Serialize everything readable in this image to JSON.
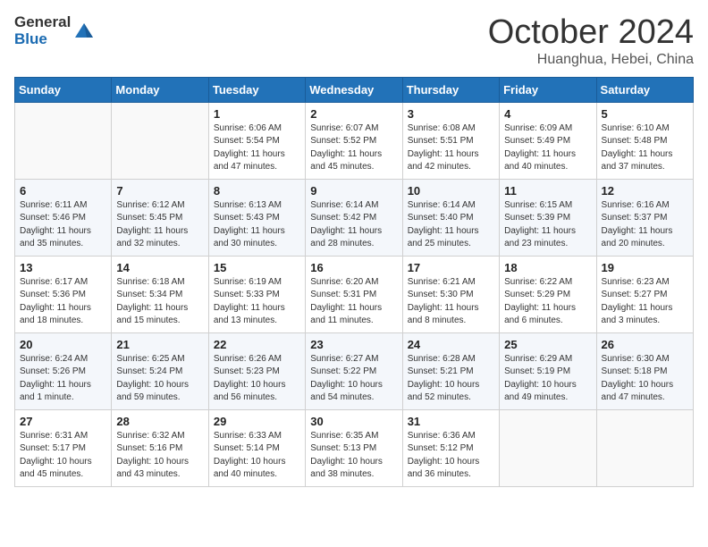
{
  "header": {
    "logo_general": "General",
    "logo_blue": "Blue",
    "month_title": "October 2024",
    "location": "Huanghua, Hebei, China"
  },
  "weekdays": [
    "Sunday",
    "Monday",
    "Tuesday",
    "Wednesday",
    "Thursday",
    "Friday",
    "Saturday"
  ],
  "weeks": [
    [
      null,
      null,
      {
        "day": "1",
        "sunrise": "Sunrise: 6:06 AM",
        "sunset": "Sunset: 5:54 PM",
        "daylight": "Daylight: 11 hours and 47 minutes."
      },
      {
        "day": "2",
        "sunrise": "Sunrise: 6:07 AM",
        "sunset": "Sunset: 5:52 PM",
        "daylight": "Daylight: 11 hours and 45 minutes."
      },
      {
        "day": "3",
        "sunrise": "Sunrise: 6:08 AM",
        "sunset": "Sunset: 5:51 PM",
        "daylight": "Daylight: 11 hours and 42 minutes."
      },
      {
        "day": "4",
        "sunrise": "Sunrise: 6:09 AM",
        "sunset": "Sunset: 5:49 PM",
        "daylight": "Daylight: 11 hours and 40 minutes."
      },
      {
        "day": "5",
        "sunrise": "Sunrise: 6:10 AM",
        "sunset": "Sunset: 5:48 PM",
        "daylight": "Daylight: 11 hours and 37 minutes."
      }
    ],
    [
      {
        "day": "6",
        "sunrise": "Sunrise: 6:11 AM",
        "sunset": "Sunset: 5:46 PM",
        "daylight": "Daylight: 11 hours and 35 minutes."
      },
      {
        "day": "7",
        "sunrise": "Sunrise: 6:12 AM",
        "sunset": "Sunset: 5:45 PM",
        "daylight": "Daylight: 11 hours and 32 minutes."
      },
      {
        "day": "8",
        "sunrise": "Sunrise: 6:13 AM",
        "sunset": "Sunset: 5:43 PM",
        "daylight": "Daylight: 11 hours and 30 minutes."
      },
      {
        "day": "9",
        "sunrise": "Sunrise: 6:14 AM",
        "sunset": "Sunset: 5:42 PM",
        "daylight": "Daylight: 11 hours and 28 minutes."
      },
      {
        "day": "10",
        "sunrise": "Sunrise: 6:14 AM",
        "sunset": "Sunset: 5:40 PM",
        "daylight": "Daylight: 11 hours and 25 minutes."
      },
      {
        "day": "11",
        "sunrise": "Sunrise: 6:15 AM",
        "sunset": "Sunset: 5:39 PM",
        "daylight": "Daylight: 11 hours and 23 minutes."
      },
      {
        "day": "12",
        "sunrise": "Sunrise: 6:16 AM",
        "sunset": "Sunset: 5:37 PM",
        "daylight": "Daylight: 11 hours and 20 minutes."
      }
    ],
    [
      {
        "day": "13",
        "sunrise": "Sunrise: 6:17 AM",
        "sunset": "Sunset: 5:36 PM",
        "daylight": "Daylight: 11 hours and 18 minutes."
      },
      {
        "day": "14",
        "sunrise": "Sunrise: 6:18 AM",
        "sunset": "Sunset: 5:34 PM",
        "daylight": "Daylight: 11 hours and 15 minutes."
      },
      {
        "day": "15",
        "sunrise": "Sunrise: 6:19 AM",
        "sunset": "Sunset: 5:33 PM",
        "daylight": "Daylight: 11 hours and 13 minutes."
      },
      {
        "day": "16",
        "sunrise": "Sunrise: 6:20 AM",
        "sunset": "Sunset: 5:31 PM",
        "daylight": "Daylight: 11 hours and 11 minutes."
      },
      {
        "day": "17",
        "sunrise": "Sunrise: 6:21 AM",
        "sunset": "Sunset: 5:30 PM",
        "daylight": "Daylight: 11 hours and 8 minutes."
      },
      {
        "day": "18",
        "sunrise": "Sunrise: 6:22 AM",
        "sunset": "Sunset: 5:29 PM",
        "daylight": "Daylight: 11 hours and 6 minutes."
      },
      {
        "day": "19",
        "sunrise": "Sunrise: 6:23 AM",
        "sunset": "Sunset: 5:27 PM",
        "daylight": "Daylight: 11 hours and 3 minutes."
      }
    ],
    [
      {
        "day": "20",
        "sunrise": "Sunrise: 6:24 AM",
        "sunset": "Sunset: 5:26 PM",
        "daylight": "Daylight: 11 hours and 1 minute."
      },
      {
        "day": "21",
        "sunrise": "Sunrise: 6:25 AM",
        "sunset": "Sunset: 5:24 PM",
        "daylight": "Daylight: 10 hours and 59 minutes."
      },
      {
        "day": "22",
        "sunrise": "Sunrise: 6:26 AM",
        "sunset": "Sunset: 5:23 PM",
        "daylight": "Daylight: 10 hours and 56 minutes."
      },
      {
        "day": "23",
        "sunrise": "Sunrise: 6:27 AM",
        "sunset": "Sunset: 5:22 PM",
        "daylight": "Daylight: 10 hours and 54 minutes."
      },
      {
        "day": "24",
        "sunrise": "Sunrise: 6:28 AM",
        "sunset": "Sunset: 5:21 PM",
        "daylight": "Daylight: 10 hours and 52 minutes."
      },
      {
        "day": "25",
        "sunrise": "Sunrise: 6:29 AM",
        "sunset": "Sunset: 5:19 PM",
        "daylight": "Daylight: 10 hours and 49 minutes."
      },
      {
        "day": "26",
        "sunrise": "Sunrise: 6:30 AM",
        "sunset": "Sunset: 5:18 PM",
        "daylight": "Daylight: 10 hours and 47 minutes."
      }
    ],
    [
      {
        "day": "27",
        "sunrise": "Sunrise: 6:31 AM",
        "sunset": "Sunset: 5:17 PM",
        "daylight": "Daylight: 10 hours and 45 minutes."
      },
      {
        "day": "28",
        "sunrise": "Sunrise: 6:32 AM",
        "sunset": "Sunset: 5:16 PM",
        "daylight": "Daylight: 10 hours and 43 minutes."
      },
      {
        "day": "29",
        "sunrise": "Sunrise: 6:33 AM",
        "sunset": "Sunset: 5:14 PM",
        "daylight": "Daylight: 10 hours and 40 minutes."
      },
      {
        "day": "30",
        "sunrise": "Sunrise: 6:35 AM",
        "sunset": "Sunset: 5:13 PM",
        "daylight": "Daylight: 10 hours and 38 minutes."
      },
      {
        "day": "31",
        "sunrise": "Sunrise: 6:36 AM",
        "sunset": "Sunset: 5:12 PM",
        "daylight": "Daylight: 10 hours and 36 minutes."
      },
      null,
      null
    ]
  ]
}
